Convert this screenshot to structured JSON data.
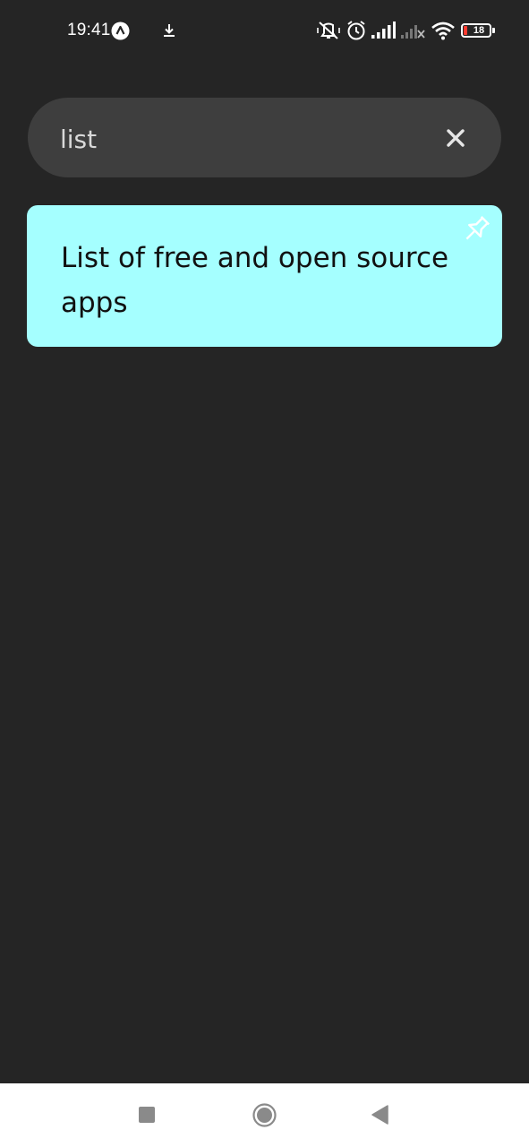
{
  "status_bar": {
    "time": "19:41",
    "battery_level": "18",
    "icons": [
      "assistant-icon",
      "download-icon",
      "vibrate-mute-icon",
      "alarm-icon",
      "signal-icon",
      "no-signal-icon",
      "wifi-icon",
      "battery-icon"
    ]
  },
  "search": {
    "value": "list",
    "clear_icon": "close-icon"
  },
  "results": [
    {
      "title": "List of free and open source apps",
      "pinned": true,
      "color": "#a5ffff"
    }
  ],
  "colors": {
    "background": "#252525",
    "search_bg": "#3e3e3e",
    "note_bg": "#a5ffff",
    "nav_bg": "#ffffff"
  },
  "nav_bar": {
    "buttons": [
      "recents-button",
      "home-button",
      "back-button"
    ]
  }
}
